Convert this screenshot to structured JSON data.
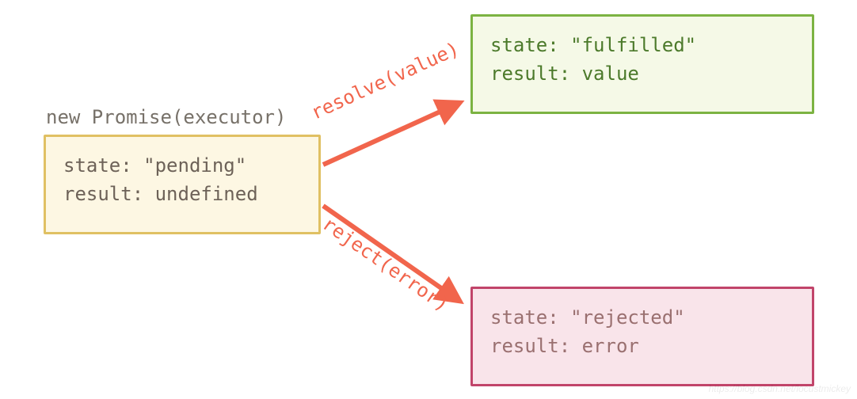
{
  "initial": {
    "caption": "new Promise(executor)",
    "state_label": "state:",
    "state_value": "\"pending\"",
    "result_label": "result:",
    "result_value": "undefined"
  },
  "fulfilled": {
    "state_label": "state:",
    "state_value": "\"fulfilled\"",
    "result_label": "result:",
    "result_value": "value"
  },
  "rejected": {
    "state_label": "state:",
    "state_value": "\"rejected\"",
    "result_label": "result:",
    "result_value": "error"
  },
  "arrows": {
    "resolve_label": "resolve(value)",
    "reject_label": "reject(error)"
  },
  "colors": {
    "arrow": "#f1654c",
    "pending_border": "#e0c063",
    "pending_bg": "#fdf7e3",
    "fulfilled_border": "#7cb342",
    "fulfilled_bg": "#f5f9e7",
    "rejected_border": "#c1446a",
    "rejected_bg": "#f9e4ea"
  },
  "watermark": "https://blog.csdn.net/locustmickey",
  "chart_data": {
    "type": "diagram",
    "nodes": [
      {
        "id": "pending",
        "label": "new Promise(executor)",
        "state": "pending",
        "result": "undefined"
      },
      {
        "id": "fulfilled",
        "state": "fulfilled",
        "result": "value"
      },
      {
        "id": "rejected",
        "state": "rejected",
        "result": "error"
      }
    ],
    "edges": [
      {
        "from": "pending",
        "to": "fulfilled",
        "label": "resolve(value)"
      },
      {
        "from": "pending",
        "to": "rejected",
        "label": "reject(error)"
      }
    ]
  }
}
